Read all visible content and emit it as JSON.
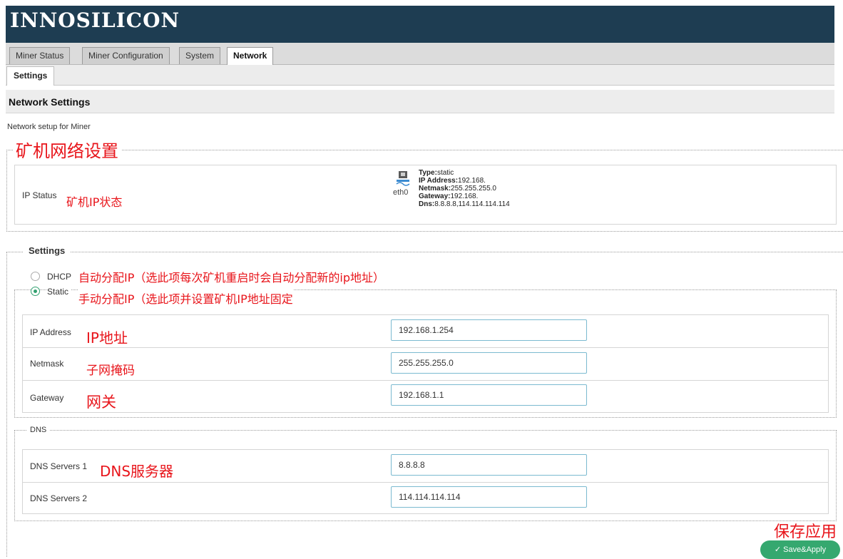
{
  "header": {
    "logo": "INNOSILICON"
  },
  "tabs": [
    {
      "label": "Miner Status"
    },
    {
      "label": "Miner Configuration"
    },
    {
      "label": "System"
    },
    {
      "label": "Network"
    }
  ],
  "subtabs": {
    "settings": "Settings"
  },
  "page": {
    "title": "Network Settings",
    "desc": "Network setup for Miner",
    "annot_title": "矿机网络设置"
  },
  "ip_status": {
    "label": "IP Status",
    "annot": "矿机IP状态",
    "iface": "eth0",
    "type_label": "Type:",
    "type_val": "static",
    "ip_label": "IP Address:",
    "ip_val": "192.168.",
    "mask_label": "Netmask:",
    "mask_val": "255.255.255.0",
    "gw_label": "Gateway:",
    "gw_val": "192.168.",
    "dns_label": "Dns:",
    "dns_val": "8.8.8.8,114.114.114.114"
  },
  "settings": {
    "legend": "Settings",
    "dhcp_label": "DHCP",
    "dhcp_annot": "自动分配IP（选此项每次矿机重启时会自动分配新的ip地址）",
    "static_label": "Static",
    "static_annot": "手动分配IP（选此项并设置矿机IP地址固定",
    "ip": {
      "label": "IP Address",
      "annot": "IP地址",
      "value": "192.168.1.254"
    },
    "mask": {
      "label": "Netmask",
      "annot": "子网掩码",
      "value": "255.255.255.0"
    },
    "gw": {
      "label": "Gateway",
      "annot": "网关",
      "value": "192.168.1.1"
    }
  },
  "dns": {
    "legend": "DNS",
    "s1": {
      "label": "DNS Servers 1",
      "annot": "DNS服务器",
      "value": "8.8.8.8"
    },
    "s2": {
      "label": "DNS Servers 2",
      "value": "114.114.114.114"
    }
  },
  "save": {
    "annot": "保存应用",
    "label": "Save&Apply"
  }
}
